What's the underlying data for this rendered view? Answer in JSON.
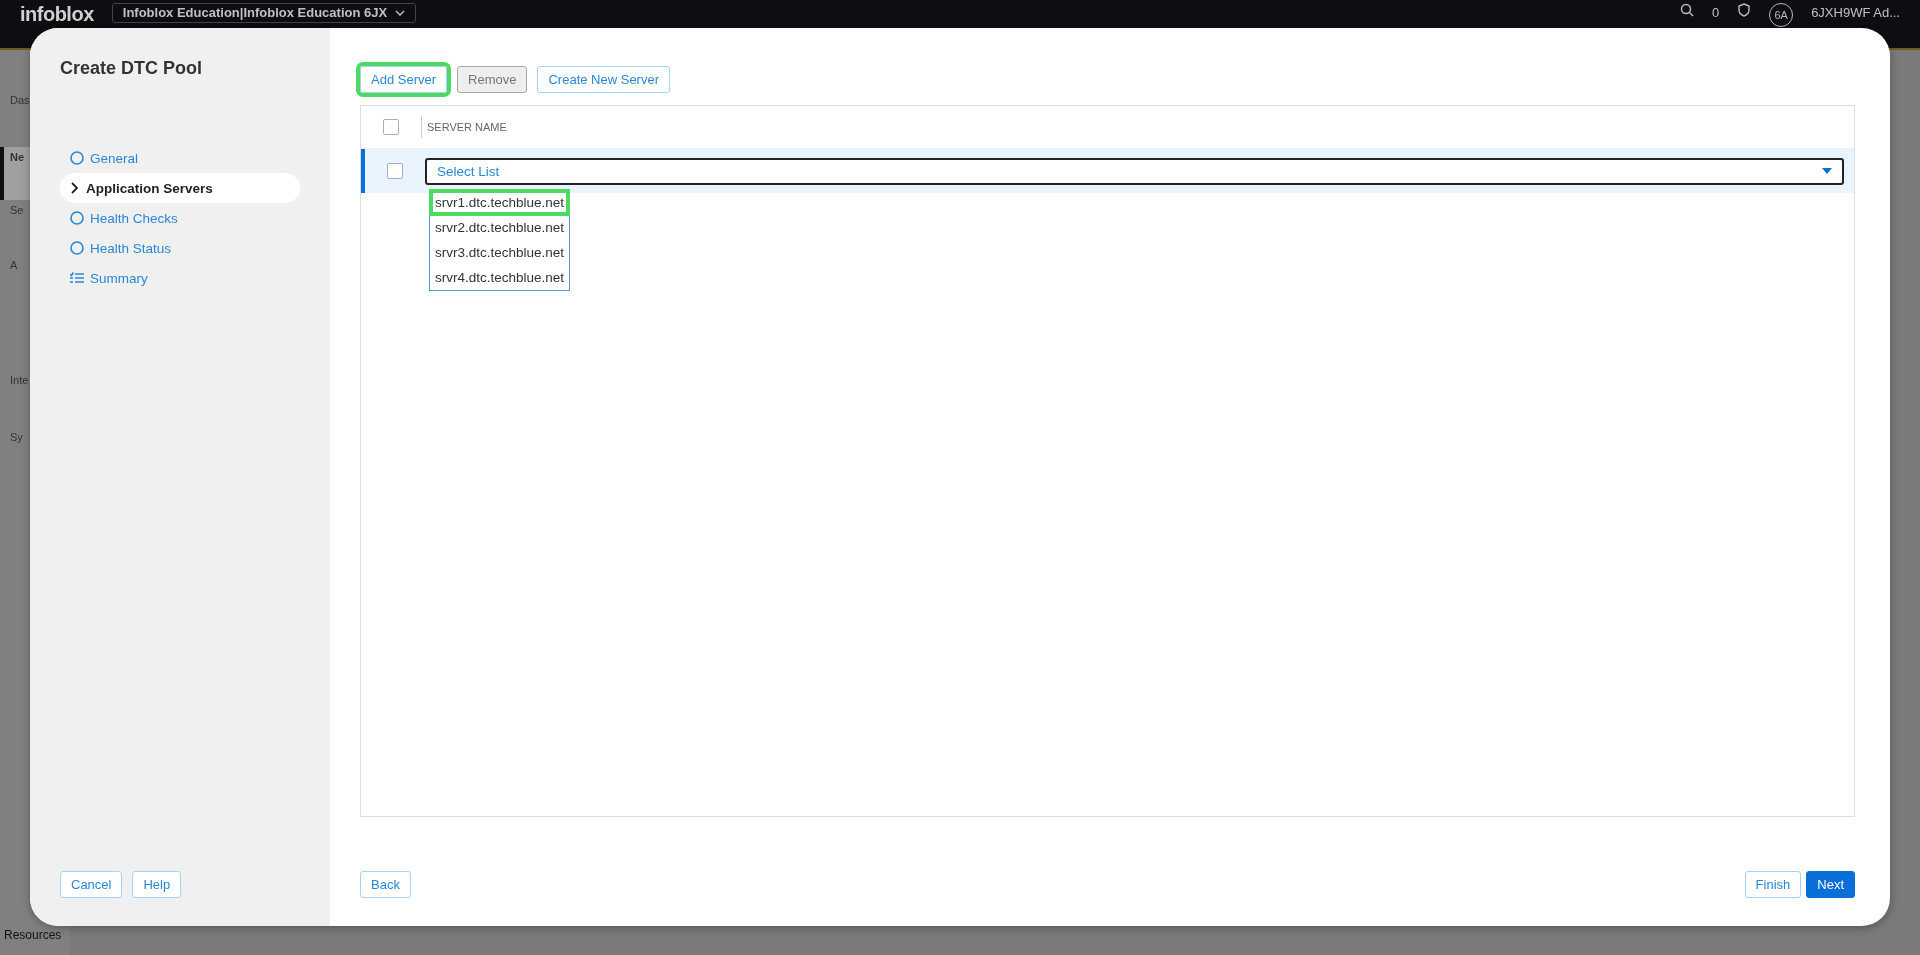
{
  "top_bar": {
    "logo": "infoblox",
    "account": "Infoblox Education|Infoblox Education 6JX",
    "count": "0",
    "avatar": "6A",
    "user": "6JXH9WF Ad..."
  },
  "background_sidebar": [
    {
      "label": "Das",
      "selected": false
    },
    {
      "label": "Ne",
      "selected": true
    },
    {
      "label": "Se",
      "selected": false
    },
    {
      "label": "A",
      "selected": false
    },
    {
      "label": "Inte",
      "selected": false
    },
    {
      "label": "Sy",
      "selected": false
    }
  ],
  "background_footer": "Resources",
  "dialog": {
    "title": "Create DTC Pool",
    "steps": [
      {
        "label": "General",
        "kind": "step",
        "selected": false
      },
      {
        "label": "Application Servers",
        "kind": "step",
        "selected": true
      },
      {
        "label": "Health Checks",
        "kind": "step",
        "selected": false
      },
      {
        "label": "Health Status",
        "kind": "step",
        "selected": false
      },
      {
        "label": "Summary",
        "kind": "summary",
        "selected": false
      }
    ],
    "left_buttons": [
      "Cancel",
      "Help"
    ],
    "toolbar": [
      {
        "label": "Add Server",
        "disabled": false,
        "highlighted": true
      },
      {
        "label": "Remove",
        "disabled": true,
        "highlighted": false
      },
      {
        "label": "Create New Server",
        "disabled": false,
        "highlighted": false
      }
    ],
    "table": {
      "header_checked": false,
      "columns": [
        "SERVER NAME"
      ],
      "rows": [
        {
          "checked": false,
          "select": {
            "value": "Select List",
            "expanded": true,
            "options": [
              {
                "label": "srvr1.dtc.techblue.net",
                "highlighted": true
              },
              {
                "label": "srvr2.dtc.techblue.net",
                "highlighted": false
              },
              {
                "label": "srvr3.dtc.techblue.net",
                "highlighted": false
              },
              {
                "label": "srvr4.dtc.techblue.net",
                "highlighted": false
              }
            ]
          }
        }
      ]
    },
    "back_button": "Back",
    "footer_buttons": [
      {
        "label": "Finish",
        "primary": false
      },
      {
        "label": "Next",
        "primary": true
      }
    ]
  }
}
